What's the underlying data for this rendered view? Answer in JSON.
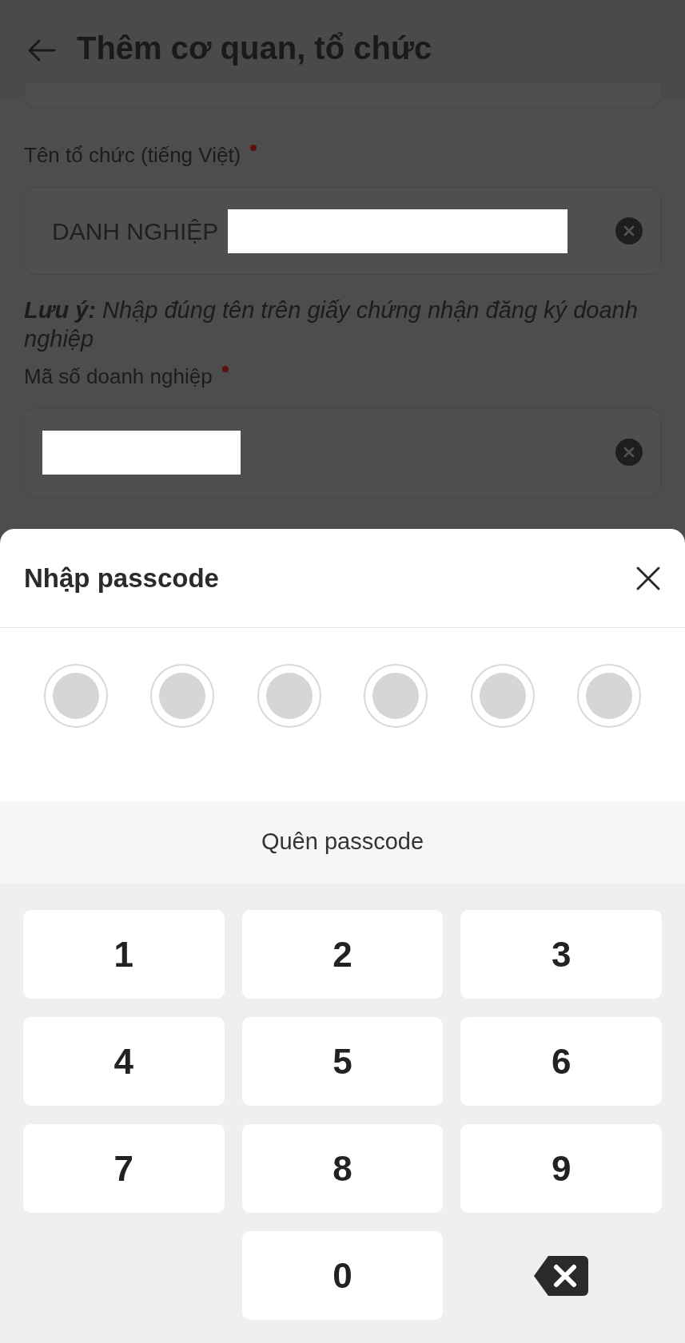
{
  "header": {
    "title": "Thêm cơ quan, tổ chức"
  },
  "form": {
    "fields": [
      {
        "label": "Tên tổ chức (tiếng Việt)",
        "required": true,
        "value": "DANH NGHIỆP",
        "redacted": true,
        "clearable": true
      },
      {
        "label": "Mã số doanh nghiệp",
        "required": true,
        "redacted": true,
        "clearable": true
      }
    ],
    "note": "**Lưu ý:** Nhập đúng tên trên giấy chứng nhận đăng ký doanh nghiệp"
  },
  "sheet": {
    "title": "Nhập passcode",
    "dots": [
      {
        "filled": false
      },
      {
        "filled": false
      },
      {
        "filled": false
      },
      {
        "filled": false
      },
      {
        "filled": false
      },
      {
        "filled": false
      }
    ],
    "forgot": "Quên passcode",
    "keys": [
      {
        "kind": "digit",
        "label": "1"
      },
      {
        "kind": "digit",
        "label": "2"
      },
      {
        "kind": "digit",
        "label": "3"
      },
      {
        "kind": "digit",
        "label": "4"
      },
      {
        "kind": "digit",
        "label": "5"
      },
      {
        "kind": "digit",
        "label": "6"
      },
      {
        "kind": "digit",
        "label": "7"
      },
      {
        "kind": "digit",
        "label": "8"
      },
      {
        "kind": "digit",
        "label": "9"
      },
      {
        "kind": "blank"
      },
      {
        "kind": "digit",
        "label": "0"
      },
      {
        "kind": "backspace"
      }
    ]
  }
}
